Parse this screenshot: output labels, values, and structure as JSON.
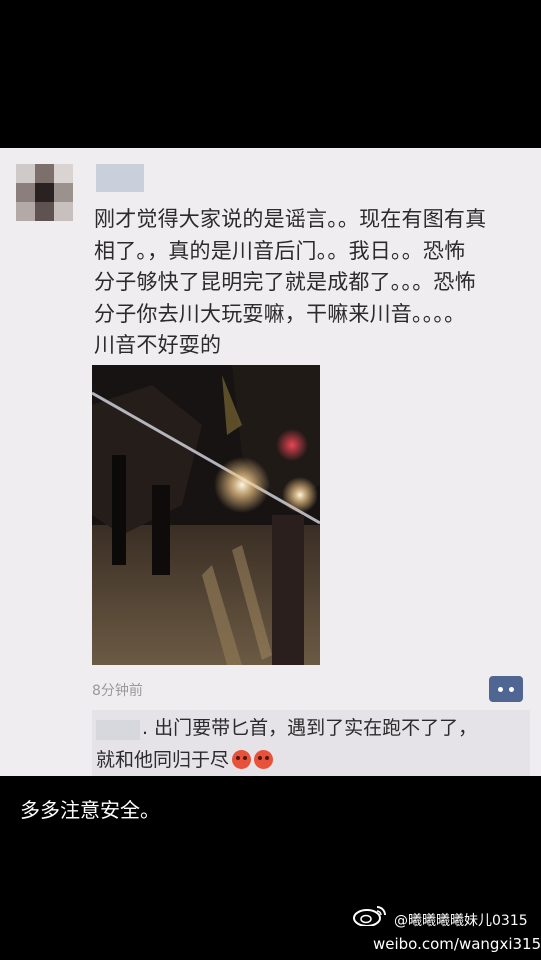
{
  "post": {
    "text_lines": [
      "刚才觉得大家说的是谣言。。现在有图有真",
      "相了。，真的是川音后门。。我日。。恐怖",
      "分子够快了昆明完了就是成都了。。。恐怖",
      "分子你去川大玩耍嘛，干嘛来川音。。。。",
      "川音不好耍的"
    ],
    "timestamp": "8分钟前",
    "reply": {
      "line1": ". 出门要带匕首，遇到了实在跑不了了，",
      "line2": "就和他同归于尽"
    }
  },
  "caption": "多多注意安全。",
  "watermark": {
    "handle": "@曦曦曦曦妹儿0315",
    "url": "weibo.com/wangxi315"
  },
  "colors": {
    "background": "#000000",
    "post_bg": "#f0edf0",
    "comment_button": "#4e6691",
    "emoji": "#e8523a"
  },
  "icons": [
    "comment-icon",
    "angry-emoji-icon",
    "weibo-logo-icon"
  ]
}
